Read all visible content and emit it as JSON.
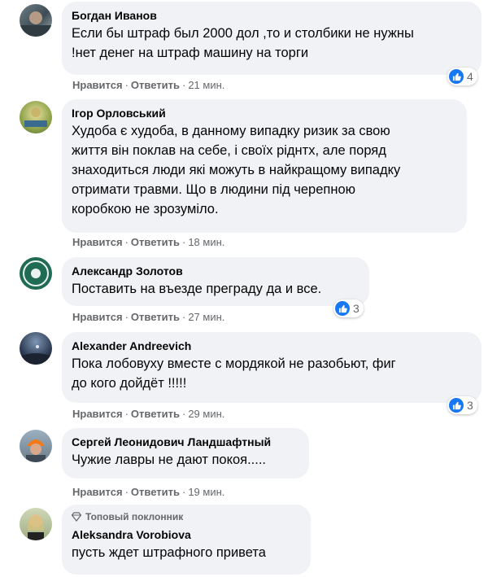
{
  "colors": {
    "bubble": "#f0f2f5",
    "like_blue": "#1877f2",
    "meta_gray": "#65676b"
  },
  "comments": [
    {
      "name": "Богдан Иванов",
      "lines": [
        "Если бы штраф был 2000 дол ,то и столбики не нужны",
        "!нет денег на штраф машину на торги"
      ],
      "like": "Нравится",
      "reply": "Ответить",
      "time": "21 мин.",
      "reactions": "4"
    },
    {
      "name": "Ігор Орловський",
      "lines": [
        "Худоба є худоба, в данному випадку ризик за свою",
        "життя він поклав на себе, і своїх ріднтх, але поряд",
        "знаходиться люди які можуть в найкращому випадку",
        "отримати травми. Що в людини під черепною",
        "коробкою не зрозуміло."
      ],
      "like": "Нравится",
      "reply": "Ответить",
      "time": "18 мин."
    },
    {
      "name": "Александр Золотов",
      "lines": [
        "Поставить на въезде преграду да и все."
      ],
      "like": "Нравится",
      "reply": "Ответить",
      "time": "27 мин.",
      "reactions": "3"
    },
    {
      "name": "Alexander Andreevich",
      "lines": [
        "Пока лобовуху вместе с мордякой не разобьют, фиг",
        "до кого дойдёт !!!!!"
      ],
      "like": "Нравится",
      "reply": "Ответить",
      "time": "29 мин.",
      "reactions": "3"
    },
    {
      "name": "Сергей Леонидович Ландшафтный",
      "lines": [
        "Чужие лавры не дают покоя....."
      ],
      "like": "Нравится",
      "reply": "Ответить",
      "time": "19 мин."
    },
    {
      "badge": "Топовый поклонник",
      "name": "Aleksandra Vorobiova",
      "lines": [
        "пусть ждет штрафного привета"
      ]
    }
  ]
}
